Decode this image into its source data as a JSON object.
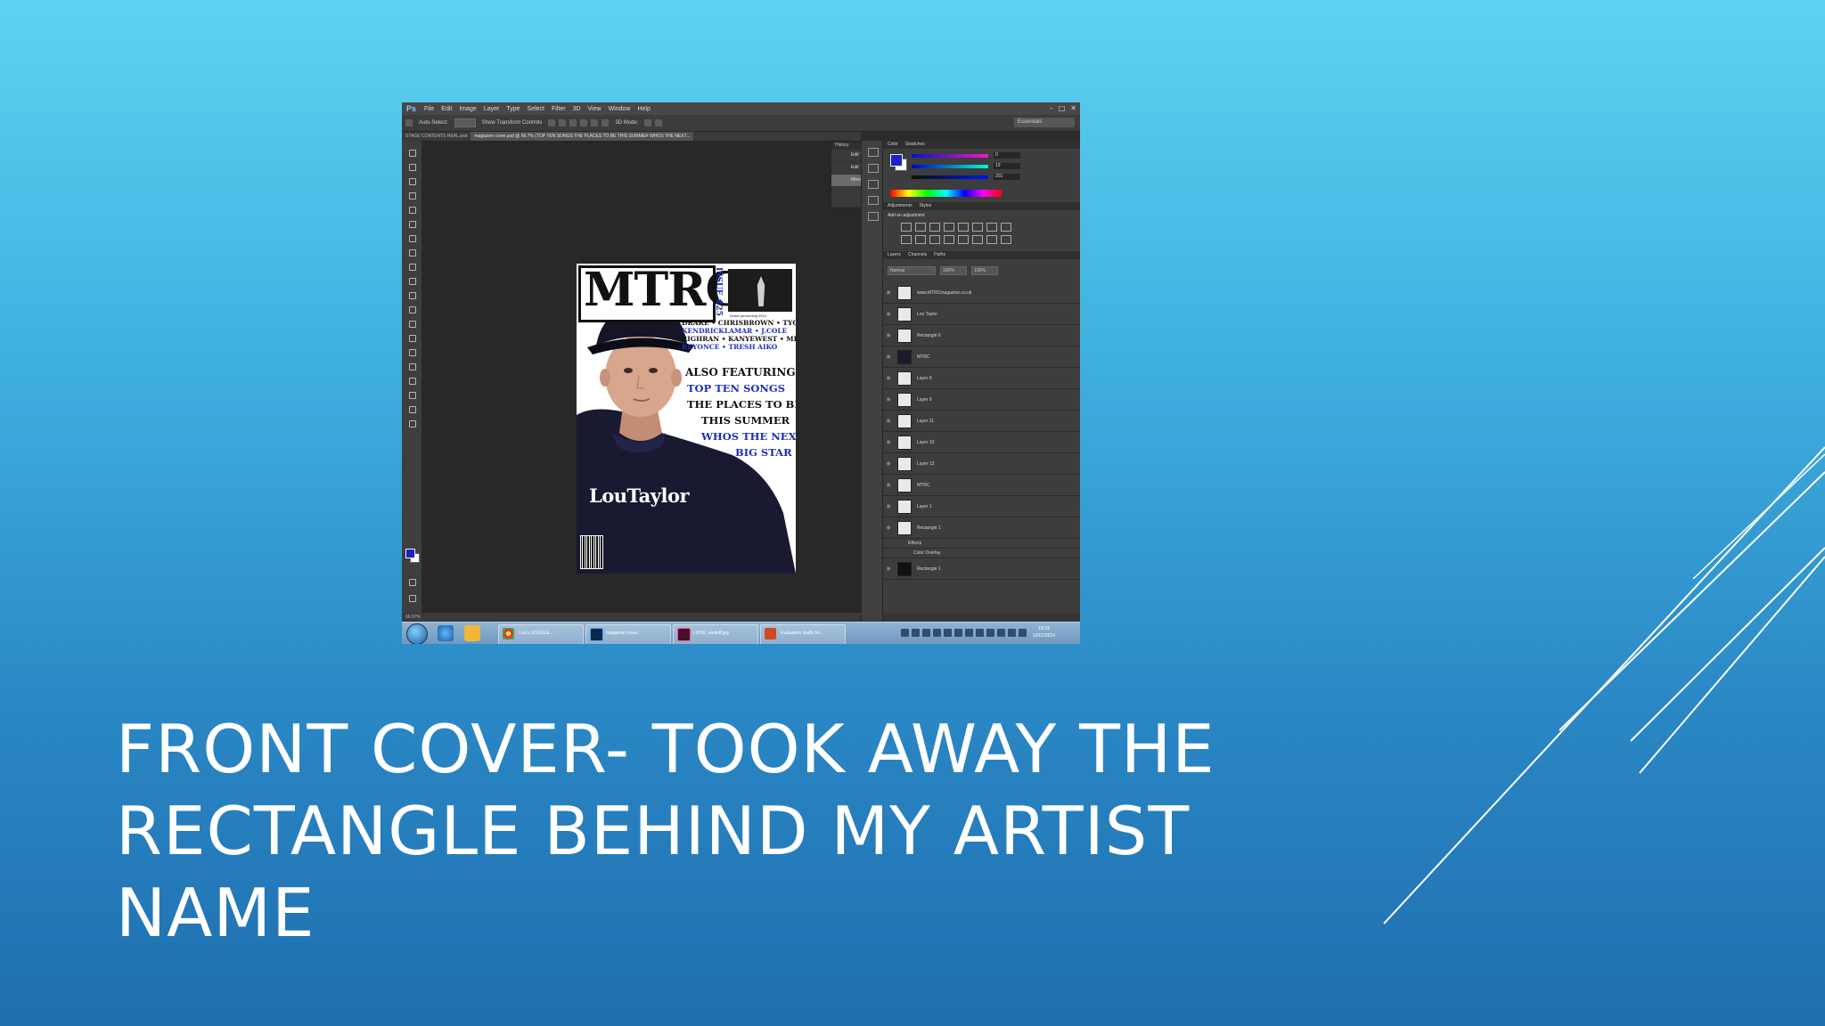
{
  "slide": {
    "title_line1": "FRONT COVER- TOOK AWAY THE",
    "title_line2": "RECTANGLE BEHIND MY ARTIST NAME"
  },
  "photoshop": {
    "logo": "Ps",
    "menu": [
      "File",
      "Edit",
      "Image",
      "Layer",
      "Type",
      "Select",
      "Filter",
      "3D",
      "View",
      "Window",
      "Help"
    ],
    "options": [
      "Auto-Select:",
      "Show Transform Controls",
      "3D Mode:"
    ],
    "workspace": "Essentials",
    "tabs": [
      "STAGE CONTENTS REAL.psd",
      "magazine cover.psd @ 66.7% (TOP TEN SONGS THE PLACES TO BE THIS SUMMER WHOS THE NEXT..."
    ],
    "status_zoom": "66.67%",
    "history": {
      "title": "History",
      "items": [
        "Edit Type Layer",
        "Edit Type Layer",
        "Move"
      ]
    },
    "panels": {
      "color_tabs": [
        "Color",
        "Swatches"
      ],
      "color_values": [
        "0",
        "19",
        "201"
      ],
      "adjustments_tabs": [
        "Adjustments",
        "Styles"
      ],
      "adjustments_title": "Add an adjustment",
      "layers_tabs": [
        "Layers",
        "Channels",
        "Paths"
      ],
      "blend_mode": "Normal",
      "opacity": "100%",
      "fill": "100%",
      "layers": [
        "www.MTRCmagazine.co.uk",
        "Lou Taylor",
        "Rectangle 6",
        "MTRC",
        "Layer 8",
        "Layer 9",
        "Layer 11",
        "Layer 10",
        "Layer 13",
        "MTRC",
        "Layer 1",
        "Rectangle 1",
        "Effects",
        "Color Overlay",
        "Rectangle 1"
      ]
    },
    "colors": {
      "foreground": "#1a22c9",
      "ui_dark": "#2b2b2b"
    }
  },
  "cover": {
    "masthead": "MTRC",
    "issue": "ISSUE #25",
    "thumb_caption": "Drake performing 2014",
    "artist_lines": [
      "DRAKE • CHRISBROWN • TYGA",
      "KENDRICKLAMAR • J.COLE",
      "RIGHRAN • KANYEWEST • MISKROSS",
      "BEYONCE • TRESH AIKO"
    ],
    "also_featuring": "ALSO FEATURING...",
    "features": [
      "TOP TEN SONGS",
      "THE PLACES TO BE",
      "THIS SUMMER",
      "WHOS THE NEXT",
      "BIG STAR"
    ],
    "artist_name": "LouTaylor"
  },
  "taskbar": {
    "windows": [
      "Lou's GOOGLE...",
      "magazine cover...",
      "LOOK, vantuff.jpg",
      "Evaluation drafts for..."
    ],
    "clock_time": "18:24",
    "clock_date": "12/01/2014"
  }
}
